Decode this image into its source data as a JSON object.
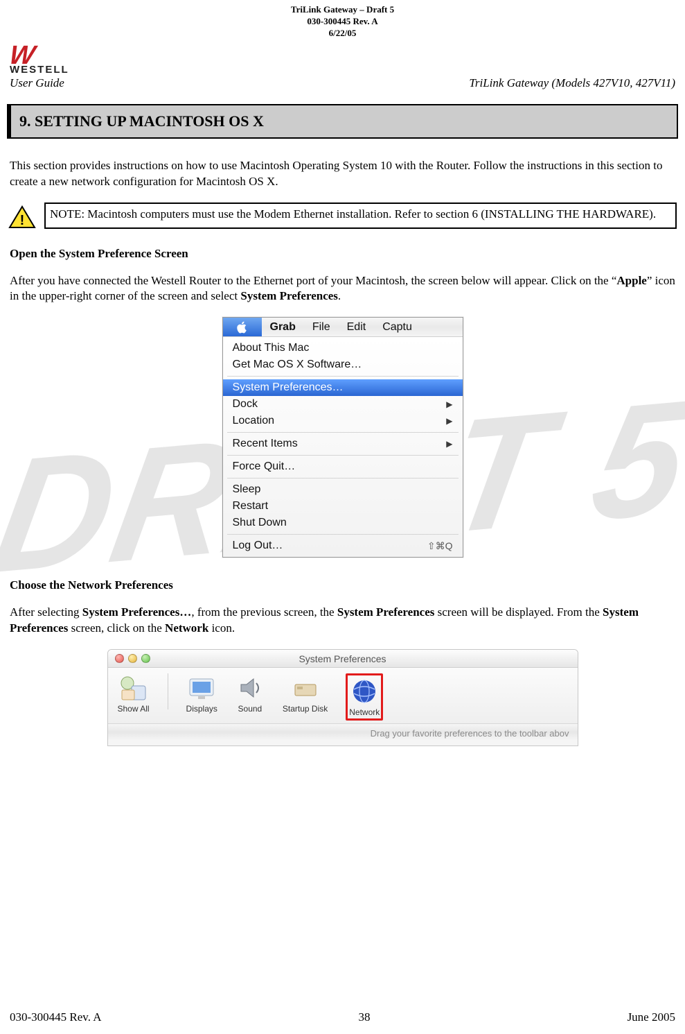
{
  "watermark_text": "DRAFT 5",
  "doc_meta": {
    "title_line1": "TriLink Gateway – Draft 5",
    "doc_number": "030-300445 Rev. A",
    "date": "6/22/05"
  },
  "logo": {
    "brand_top_glyph": "W",
    "brand_name": "WESTELL"
  },
  "header": {
    "user_guide": "User Guide",
    "models_title": "TriLink Gateway (Models 427V10, 427V11)"
  },
  "section_header": "9.   SETTING UP MACINTOSH OS X",
  "intro_para": "This section provides instructions on how to use Macintosh Operating System 10 with the Router. Follow the instructions in this section to create a new network configuration for Macintosh OS X.",
  "note_text": "NOTE: Macintosh computers must use the Modem Ethernet installation. Refer to section 6 (INSTALLING THE HARDWARE).",
  "sub1_heading": "Open the System Preference Screen",
  "sub1_para_pre": "After you have connected the Westell Router to the Ethernet port of your Macintosh, the screen below will appear. Click on the “",
  "sub1_para_bold1": "Apple",
  "sub1_para_mid": "” icon in the upper-right corner of the screen and select ",
  "sub1_para_bold2": "System Preferences",
  "sub1_para_end": ".",
  "apple_menu": {
    "menubar": {
      "apple": "",
      "items": [
        "Grab",
        "File",
        "Edit",
        "Captu"
      ]
    },
    "dropdown_items": [
      {
        "label": "About This Mac"
      },
      {
        "label": "Get Mac OS X Software…"
      },
      {
        "sep": true
      },
      {
        "label": "System Preferences…",
        "selected": true
      },
      {
        "label": "Dock",
        "submenu": true
      },
      {
        "label": "Location",
        "submenu": true
      },
      {
        "sep": true
      },
      {
        "label": "Recent Items",
        "submenu": true
      },
      {
        "sep": true
      },
      {
        "label": "Force Quit…"
      },
      {
        "sep": true
      },
      {
        "label": "Sleep"
      },
      {
        "label": "Restart"
      },
      {
        "label": "Shut Down"
      },
      {
        "sep": true
      },
      {
        "label": "Log Out…",
        "shortcut": "⇧⌘Q"
      }
    ]
  },
  "sub2_heading": "Choose the Network Preferences",
  "sub2_para_pre": "After selecting ",
  "sub2_para_b1": "System Preferences…",
  "sub2_para_mid1": ", from the previous screen, the ",
  "sub2_para_b2": "System Preferences",
  "sub2_para_mid2": " screen will be displayed. From the ",
  "sub2_para_b3": "System Preferences",
  "sub2_para_mid3": " screen, click on the ",
  "sub2_para_b4": "Network",
  "sub2_para_end": " icon.",
  "sysprefs": {
    "window_title": "System Preferences",
    "toolbar": [
      "Show All",
      "Displays",
      "Sound",
      "Startup Disk",
      "Network"
    ],
    "hint": "Drag your favorite preferences to the toolbar abov"
  },
  "footer": {
    "left": "030-300445 Rev. A",
    "center": "38",
    "right": "June 2005"
  }
}
